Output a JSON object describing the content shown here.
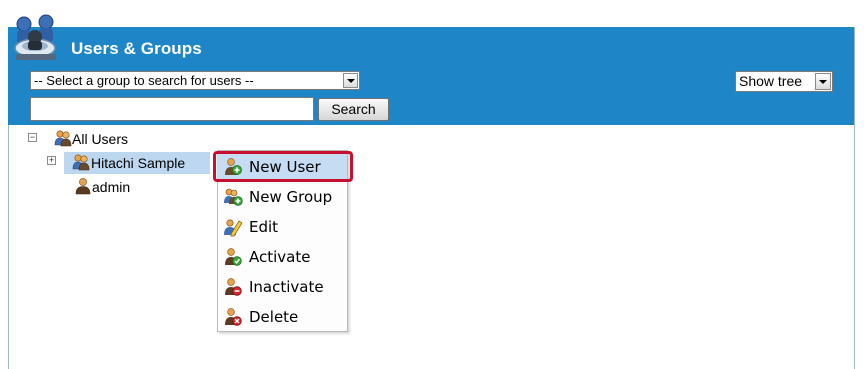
{
  "header": {
    "title": "Users & Groups",
    "group_select": {
      "value": "-- Select a group to search for users --"
    },
    "search_input": {
      "value": ""
    },
    "search_button": "Search",
    "view_select": {
      "value": "Show tree"
    }
  },
  "tree": {
    "root": {
      "label": "All Users",
      "toggle": "−"
    },
    "children": [
      {
        "label": "Hitachi Sample",
        "toggle": "+"
      },
      {
        "label": "admin"
      }
    ]
  },
  "context_menu": {
    "items": [
      {
        "label": "New User",
        "icon": "user-add-icon"
      },
      {
        "label": "New Group",
        "icon": "group-add-icon"
      },
      {
        "label": "Edit",
        "icon": "user-edit-icon"
      },
      {
        "label": "Activate",
        "icon": "user-activate-icon"
      },
      {
        "label": "Inactivate",
        "icon": "user-inactivate-icon"
      },
      {
        "label": "Delete",
        "icon": "user-delete-icon"
      }
    ],
    "highlighted": "New User"
  },
  "colors": {
    "header_bg": "#1e86c6",
    "highlight_border": "#c8102e",
    "selection_bg": "#bcd7ef"
  }
}
